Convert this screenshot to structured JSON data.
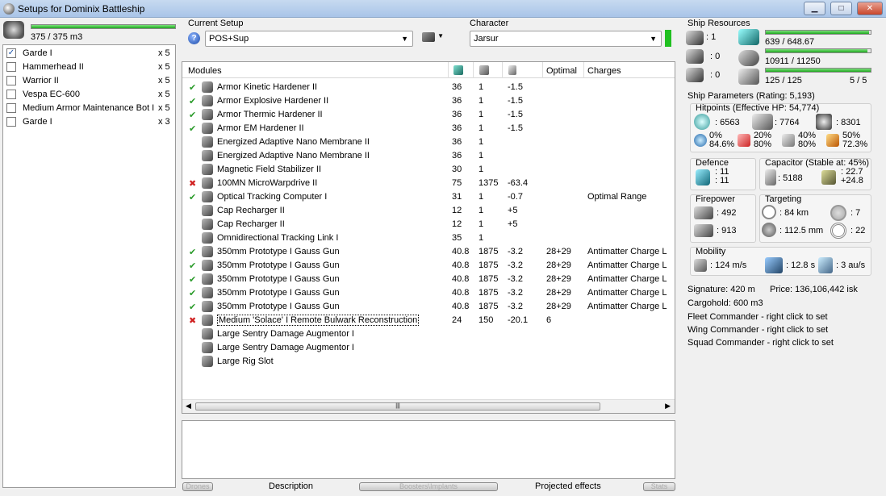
{
  "window": {
    "title": "Setups for Dominix Battleship"
  },
  "drone_bay": {
    "capacity": "375 / 375 m3",
    "capacity_fraction": 1.0,
    "drones": [
      {
        "name": "Garde I",
        "qty": "x 5",
        "checked": true
      },
      {
        "name": "Hammerhead II",
        "qty": "x 5",
        "checked": false
      },
      {
        "name": "Warrior II",
        "qty": "x 5",
        "checked": false
      },
      {
        "name": "Vespa EC-600",
        "qty": "x 5",
        "checked": false
      },
      {
        "name": "Medium Armor Maintenance Bot I",
        "qty": "x 5",
        "checked": false
      },
      {
        "name": "Garde I",
        "qty": "x 3",
        "checked": false
      }
    ]
  },
  "setup": {
    "label": "Current Setup",
    "value": "POS+Sup",
    "help": "?"
  },
  "character": {
    "label": "Character",
    "value": "Jarsur"
  },
  "modules": {
    "headers": {
      "name": "Modules",
      "optimal": "Optimal",
      "charges": "Charges"
    },
    "rows": [
      {
        "status": "✔",
        "name": "Armor Kinetic Hardener II",
        "cpu": "36",
        "pg": "1",
        "cap": "-1.5",
        "optimal": "",
        "charges": ""
      },
      {
        "status": "✔",
        "name": "Armor Explosive Hardener II",
        "cpu": "36",
        "pg": "1",
        "cap": "-1.5",
        "optimal": "",
        "charges": ""
      },
      {
        "status": "✔",
        "name": "Armor Thermic Hardener II",
        "cpu": "36",
        "pg": "1",
        "cap": "-1.5",
        "optimal": "",
        "charges": ""
      },
      {
        "status": "✔",
        "name": "Armor EM Hardener II",
        "cpu": "36",
        "pg": "1",
        "cap": "-1.5",
        "optimal": "",
        "charges": ""
      },
      {
        "status": "",
        "name": "Energized Adaptive Nano Membrane II",
        "cpu": "36",
        "pg": "1",
        "cap": "",
        "optimal": "",
        "charges": ""
      },
      {
        "status": "",
        "name": "Energized Adaptive Nano Membrane II",
        "cpu": "36",
        "pg": "1",
        "cap": "",
        "optimal": "",
        "charges": ""
      },
      {
        "status": "",
        "name": "Magnetic Field Stabilizer II",
        "cpu": "30",
        "pg": "1",
        "cap": "",
        "optimal": "",
        "charges": ""
      },
      {
        "status": "✖",
        "name": "100MN MicroWarpdrive II",
        "cpu": "75",
        "pg": "1375",
        "cap": "-63.4",
        "optimal": "",
        "charges": ""
      },
      {
        "status": "✔",
        "name": "Optical Tracking Computer I",
        "cpu": "31",
        "pg": "1",
        "cap": "-0.7",
        "optimal": "",
        "charges": "Optimal Range"
      },
      {
        "status": "",
        "name": "Cap Recharger II",
        "cpu": "12",
        "pg": "1",
        "cap": "+5",
        "optimal": "",
        "charges": ""
      },
      {
        "status": "",
        "name": "Cap Recharger II",
        "cpu": "12",
        "pg": "1",
        "cap": "+5",
        "optimal": "",
        "charges": ""
      },
      {
        "status": "",
        "name": "Omnidirectional Tracking Link I",
        "cpu": "35",
        "pg": "1",
        "cap": "",
        "optimal": "",
        "charges": ""
      },
      {
        "status": "✔",
        "name": "350mm Prototype I Gauss Gun",
        "cpu": "40.8",
        "pg": "1875",
        "cap": "-3.2",
        "optimal": "28+29",
        "charges": "Antimatter Charge L"
      },
      {
        "status": "✔",
        "name": "350mm Prototype I Gauss Gun",
        "cpu": "40.8",
        "pg": "1875",
        "cap": "-3.2",
        "optimal": "28+29",
        "charges": "Antimatter Charge L"
      },
      {
        "status": "✔",
        "name": "350mm Prototype I Gauss Gun",
        "cpu": "40.8",
        "pg": "1875",
        "cap": "-3.2",
        "optimal": "28+29",
        "charges": "Antimatter Charge L"
      },
      {
        "status": "✔",
        "name": "350mm Prototype I Gauss Gun",
        "cpu": "40.8",
        "pg": "1875",
        "cap": "-3.2",
        "optimal": "28+29",
        "charges": "Antimatter Charge L"
      },
      {
        "status": "✔",
        "name": "350mm Prototype I Gauss Gun",
        "cpu": "40.8",
        "pg": "1875",
        "cap": "-3.2",
        "optimal": "28+29",
        "charges": "Antimatter Charge L"
      },
      {
        "status": "✖",
        "name": "Medium 'Solace' I Remote Bulwark Reconstruction",
        "cpu": "24",
        "pg": "150",
        "cap": "-20.1",
        "optimal": "6",
        "charges": ""
      },
      {
        "status": "",
        "name": "Large Sentry Damage Augmentor I",
        "cpu": "",
        "pg": "",
        "cap": "",
        "optimal": "",
        "charges": ""
      },
      {
        "status": "",
        "name": "Large Sentry Damage Augmentor I",
        "cpu": "",
        "pg": "",
        "cap": "",
        "optimal": "",
        "charges": ""
      },
      {
        "status": "",
        "name": "Large Rig Slot",
        "cpu": "",
        "pg": "",
        "cap": "",
        "optimal": "",
        "charges": ""
      }
    ]
  },
  "bottom_tabs": {
    "drones": "Drones",
    "description": "Description",
    "boosters": "Boosters\\Implants",
    "projected": "Projected effects",
    "stats": "Stats"
  },
  "ship_resources": {
    "label": "Ship Resources",
    "turret_hardpoints": ": 1",
    "launcher_hardpoints": ": 0",
    "other": ": 0",
    "cpu": "639 / 648.67",
    "cpu_fraction": 0.985,
    "powergrid": "10911 / 11250",
    "powergrid_fraction": 0.97,
    "calibration": "125 / 125",
    "calibration_fraction": 1.0,
    "rigs": "5 / 5"
  },
  "ship_params": {
    "label": "Ship Parameters (Rating: 5,193)",
    "hitpoints": {
      "label": "Hitpoints (Effective HP: 54,774)",
      "shield": ": 6563",
      "armor": ": 7764",
      "structure": ": 8301",
      "em_shield": "0%",
      "em_armor": "84.6%",
      "th_shield": "20%",
      "th_armor": "80%",
      "ki_shield": "40%",
      "ki_armor": "80%",
      "ex_shield": "50%",
      "ex_armor": "72.3%"
    },
    "defence": {
      "label": "Defence",
      "v1": ": 11",
      "v2": ": 11"
    },
    "capacitor": {
      "label": "Capacitor (Stable at: 45%)",
      "cap": ": 5188",
      "r1": ": 22.7",
      "r2": "+24.8"
    },
    "firepower": {
      "label": "Firepower",
      "v1": ": 492",
      "v2": ": 913"
    },
    "targeting": {
      "label": "Targeting",
      "range": ": 84 km",
      "targets": ": 7",
      "sig": ": 112.5 mm",
      "scan": ": 22"
    },
    "mobility": {
      "label": "Mobility",
      "speed": ": 124 m/s",
      "align": ": 12.8 s",
      "warp": ": 3 au/s"
    },
    "signature": "Signature: 420 m",
    "price": "Price: 136,106,442 isk",
    "cargo": "Cargohold: 600 m3",
    "fleet": "Fleet Commander - right click to set",
    "wing": "Wing Commander - right click to set",
    "squad": "Squad Commander - right click to set"
  }
}
